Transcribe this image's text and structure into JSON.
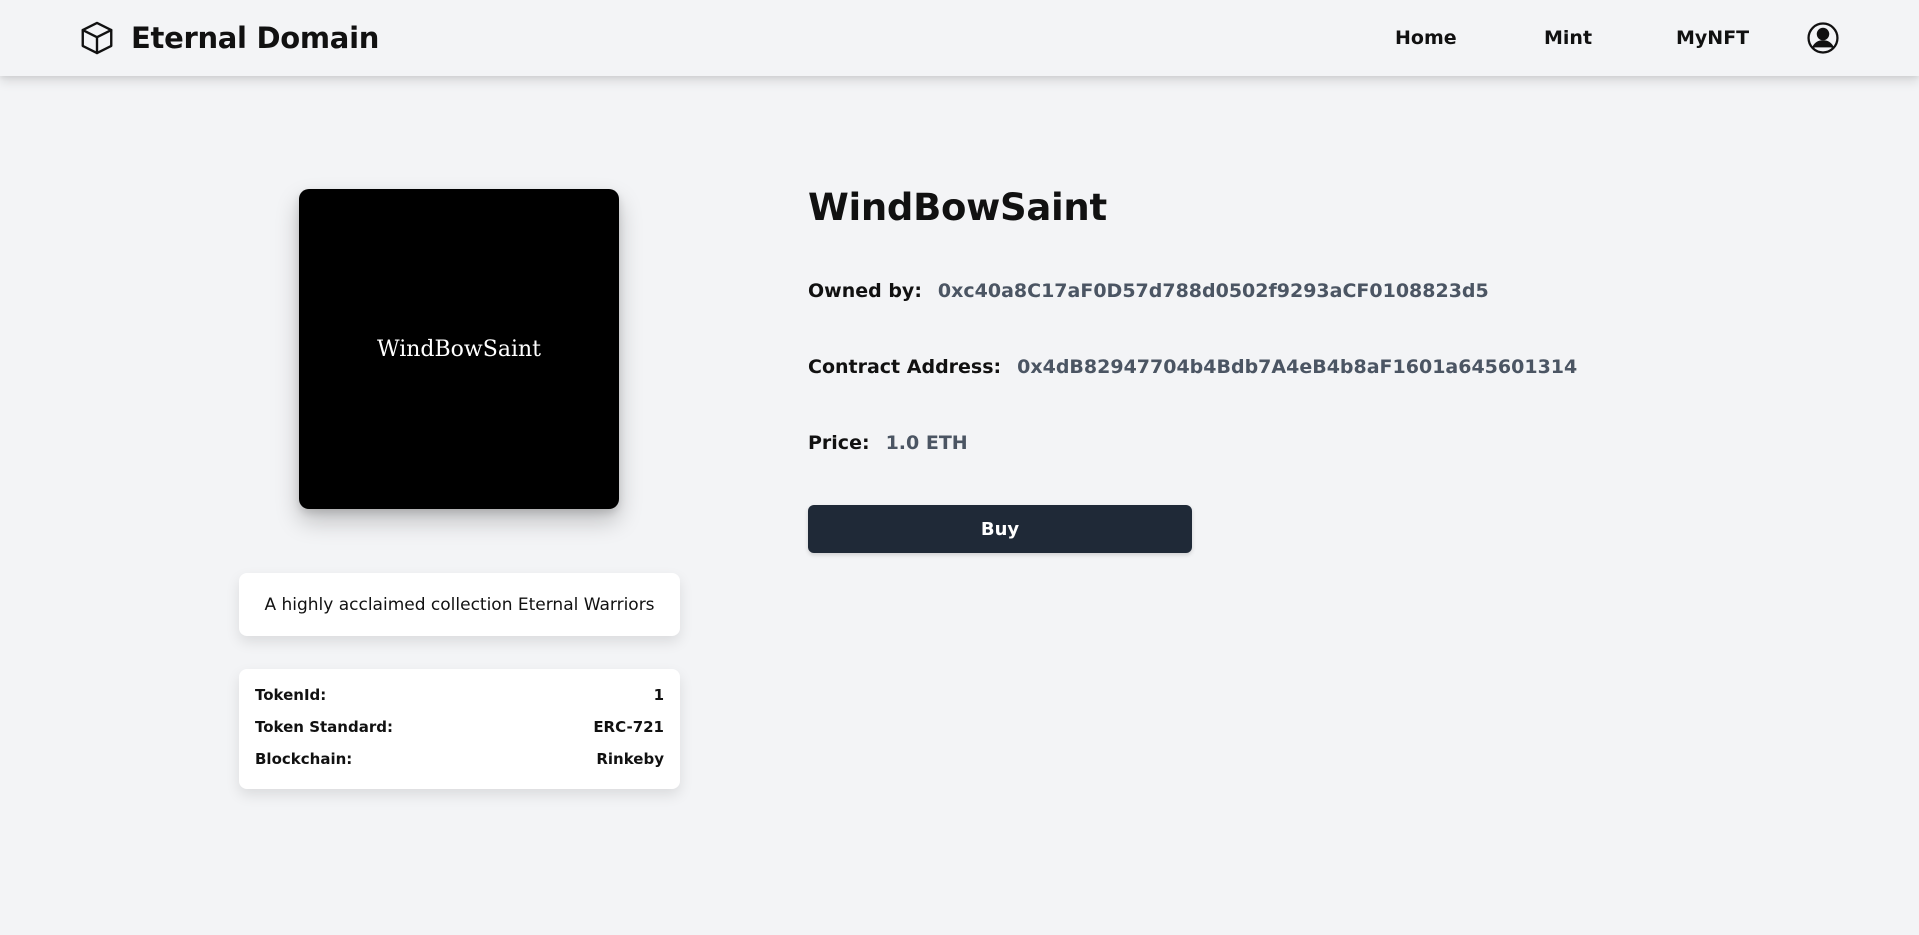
{
  "navbar": {
    "brand": "Eternal Domain",
    "brand_icon": "cube-icon",
    "links": [
      "Home",
      "Mint",
      "MyNFT"
    ],
    "profile_icon": "user-circle-icon"
  },
  "nft": {
    "image_text": "WindBowSaint",
    "title": "WindBowSaint",
    "owner_label": "Owned by:",
    "owner": "0xc40a8C17aF0D57d788d0502f9293aCF0108823d5",
    "contract_label": "Contract Address:",
    "contract": "0x4dB82947704b4Bdb7A4eB4b8aF1601a645601314",
    "price_label": "Price:",
    "price": "1.0 ETH",
    "buy_label": "Buy",
    "description": "A highly acclaimed collection Eternal Warriors",
    "details": [
      {
        "label": "TokenId:",
        "value": "1"
      },
      {
        "label": "Token Standard:",
        "value": "ERC-721"
      },
      {
        "label": "Blockchain:",
        "value": "Rinkeby"
      }
    ]
  },
  "colors": {
    "background": "#f3f4f6",
    "button": "#1f2937",
    "value_text": "#4b5563"
  }
}
